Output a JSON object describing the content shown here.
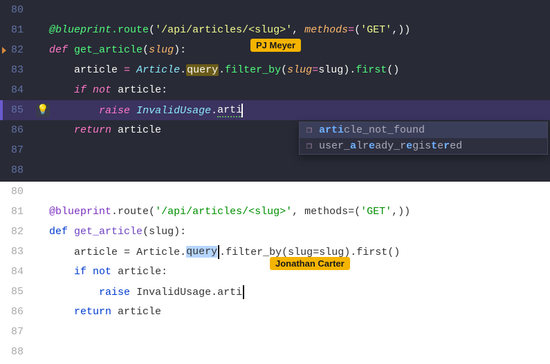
{
  "dark": {
    "lines": [
      "80",
      "81",
      "82",
      "83",
      "84",
      "85",
      "86",
      "87",
      "88"
    ],
    "route_decorator": "@blueprint",
    "route_call": ".route",
    "route_path": "'/api/articles/<slug>'",
    "methods_kw": "methods",
    "methods_val": "'GET'",
    "def": "def",
    "fn_name": "get_article",
    "param": "slug",
    "ln83_lhs": "article",
    "ln83_cls": "Article",
    "ln83_query": "query",
    "ln83_filter": "filter_by",
    "ln83_kwarg": "slug",
    "ln83_rhs": "slug",
    "ln83_first": "first",
    "if": "if",
    "not": "not",
    "cond": "article",
    "raise": "raise",
    "raise_cls": "InvalidUsage",
    "raise_tail": "arti",
    "return": "return",
    "return_v": "article",
    "tag_pj": "PJ Meyer"
  },
  "autocomplete": {
    "items": [
      {
        "pre": "arti",
        "mid": "cle_not_found",
        "match_idx": [
          0,
          1,
          2,
          3
        ]
      },
      {
        "raw": "user_already_registered",
        "matches": [
          5,
          8,
          14,
          18
        ]
      }
    ],
    "row0_full": "article_not_found",
    "row1_full": "user_already_registered"
  },
  "light": {
    "lines": [
      "80",
      "81",
      "82",
      "83",
      "84",
      "85",
      "86",
      "87",
      "88"
    ],
    "route_decorator": "@blueprint",
    "route_call": ".route",
    "route_path": "'/api/articles/<slug>'",
    "methods_kw": "methods",
    "methods_val": "'GET'",
    "def": "def",
    "fn_name": "get_article",
    "param": "slug",
    "ln83_lhs": "article",
    "ln83_cls": "Article",
    "ln83_query": "query",
    "ln83_filter": "filter_by",
    "ln83_kwarg": "slug",
    "ln83_rhs": "slug",
    "ln83_first": "first",
    "if": "if",
    "not": "not",
    "cond": "article",
    "raise": "raise",
    "raise_cls": "InvalidUsage",
    "raise_tail": "arti",
    "return": "return",
    "return_v": "article",
    "tag_jc": "Jonathan Carter"
  }
}
